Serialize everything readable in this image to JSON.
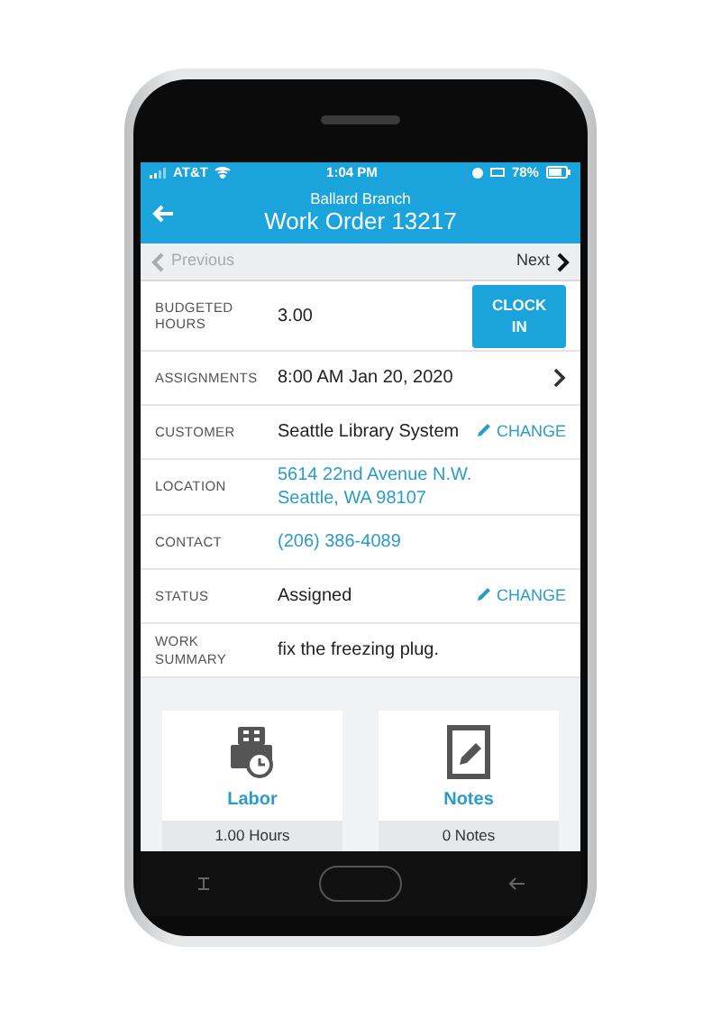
{
  "status_bar": {
    "carrier": "AT&T",
    "time": "1:04 PM",
    "battery": "78%"
  },
  "header": {
    "subtitle": "Ballard Branch",
    "title": "Work Order 13217"
  },
  "pager": {
    "previous": {
      "label": "Previous",
      "disabled": true
    },
    "next": {
      "label": "Next",
      "disabled": false
    }
  },
  "fields": [
    {
      "label": "BUDGETED HOURS",
      "value": "3.00",
      "kind": "text",
      "action": {
        "kind": "button",
        "label": "CLOCK IN"
      }
    },
    {
      "label": "ASSIGNMENTS",
      "value": "8:00 AM Jan 20, 2020",
      "kind": "text",
      "action": {
        "kind": "chevron"
      }
    },
    {
      "label": "CUSTOMER",
      "value": "Seattle Library System",
      "kind": "text",
      "action": {
        "kind": "edit",
        "label": "CHANGE"
      }
    },
    {
      "label": "LOCATION",
      "value": "5614 22nd Avenue N.W. Seattle, WA 98107",
      "kind": "link"
    },
    {
      "label": "CONTACT",
      "value": "(206) 386-4089",
      "kind": "link"
    },
    {
      "label": "STATUS",
      "value": "Assigned",
      "kind": "text",
      "action": {
        "kind": "edit",
        "label": "CHANGE"
      }
    },
    {
      "label": "WORK SUMMARY",
      "value": "fix the freezing plug.",
      "kind": "text"
    }
  ],
  "tiles": [
    {
      "kind": "labor",
      "label": "Labor",
      "summary": "1.00 Hours"
    },
    {
      "kind": "notes",
      "label": "Notes",
      "summary": "0 Notes"
    }
  ]
}
